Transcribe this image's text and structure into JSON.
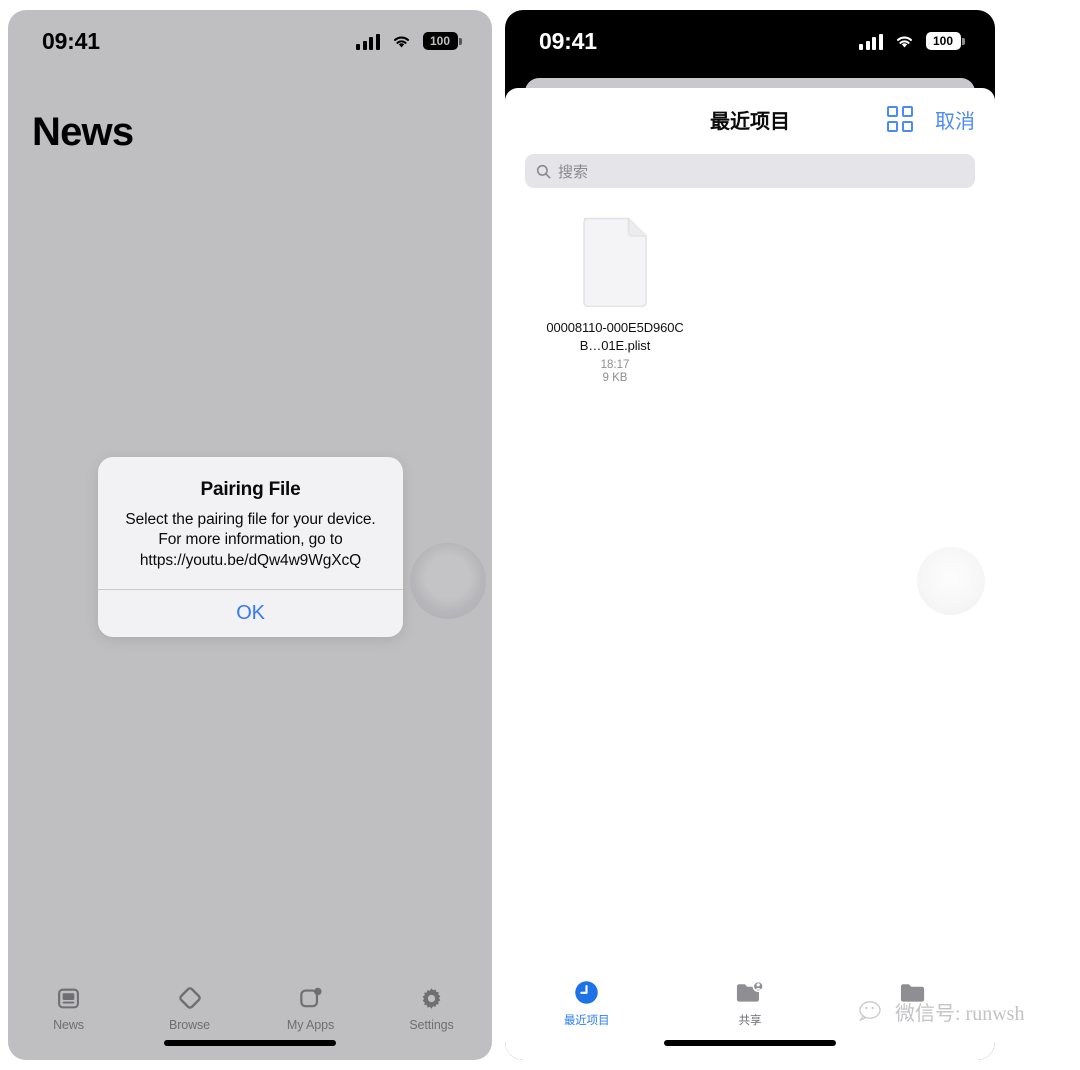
{
  "left_phone": {
    "status_bar": {
      "time": "09:41",
      "battery": "100",
      "signal_icon": "signal-bars-icon",
      "wifi_icon": "wifi-icon",
      "battery_icon": "battery-icon"
    },
    "page_title": "News",
    "alert": {
      "title": "Pairing File",
      "message": "Select the pairing file for your device. For more information, go to https://youtu.be/dQw4w9WgXcQ",
      "ok_label": "OK",
      "accent_color": "#3478f6"
    },
    "tabs": [
      {
        "label": "News",
        "icon": "news-icon",
        "active": false
      },
      {
        "label": "Browse",
        "icon": "diamond-browse-icon",
        "active": false
      },
      {
        "label": "My Apps",
        "icon": "my-apps-icon",
        "active": false
      },
      {
        "label": "Settings",
        "icon": "gear-icon",
        "active": false
      }
    ],
    "background_color": "#bfbfc2"
  },
  "right_phone": {
    "status_bar": {
      "time": "09:41",
      "battery": "100",
      "signal_icon": "signal-bars-icon",
      "wifi_icon": "wifi-icon",
      "battery_icon": "battery-icon"
    },
    "sheet": {
      "title": "最近项目",
      "grid_icon": "grid-view-icon",
      "cancel_label": "取消",
      "accent_color": "#4c8bf5",
      "search": {
        "placeholder": "搜索",
        "icon": "search-icon"
      }
    },
    "files": [
      {
        "name": "00008110-000E5D960CB…01E.plist",
        "time": "18:17",
        "size": "9 KB",
        "icon": "document-icon"
      }
    ],
    "tabs": [
      {
        "label": "最近项目",
        "icon": "clock-recents-icon",
        "active": true
      },
      {
        "label": "共享",
        "icon": "shared-folder-icon",
        "active": false
      },
      {
        "label": "",
        "icon": "folder-icon",
        "active": false
      }
    ]
  },
  "watermark": {
    "text": "微信号: runwsh",
    "icon": "wechat-icon"
  }
}
